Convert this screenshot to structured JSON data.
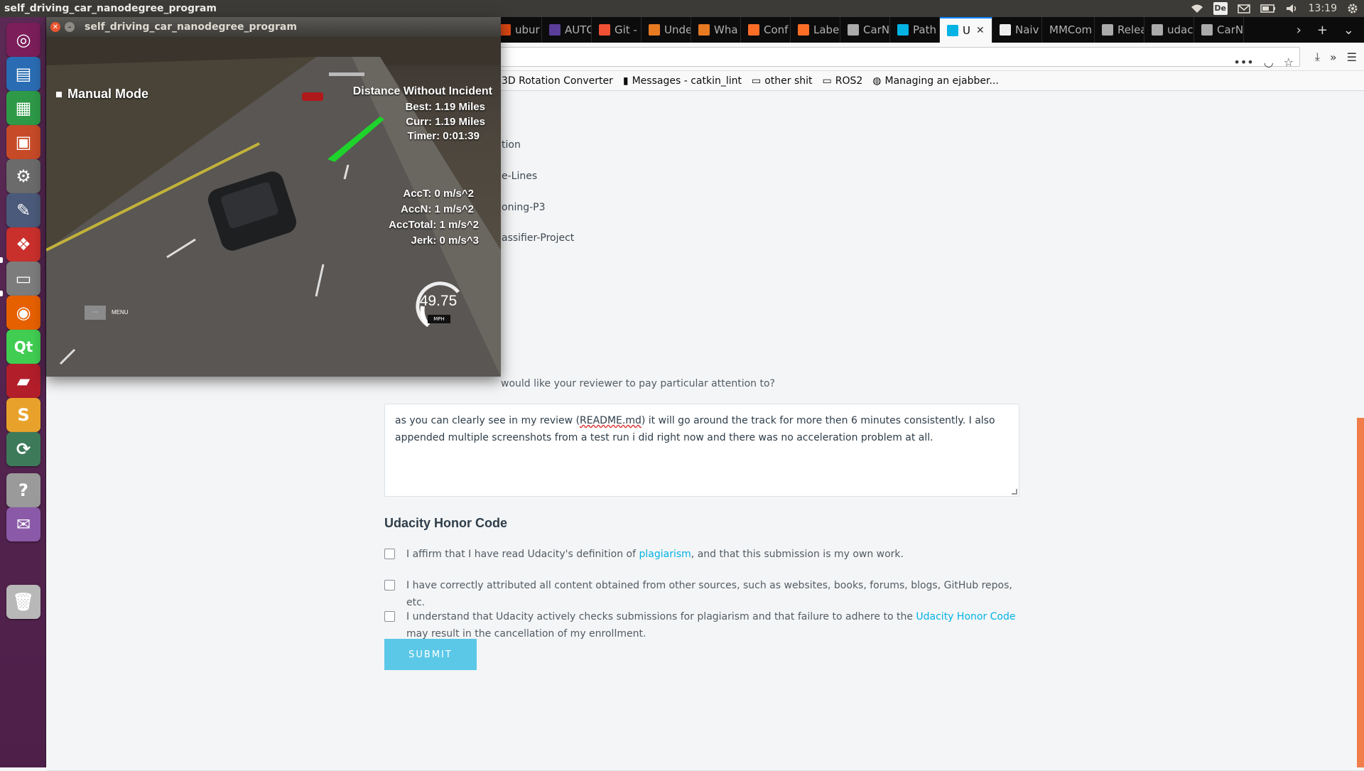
{
  "topbar": {
    "title": "self_driving_car_nanodegree_program",
    "keyboard": "De",
    "clock": "13:19"
  },
  "launcher": {
    "items": [
      {
        "name": "ubuntu-dash-icon",
        "color": "#7b1e5a"
      },
      {
        "name": "libreoffice-writer-icon",
        "color": "#2a6cb3"
      },
      {
        "name": "libreoffice-calc-icon",
        "color": "#2e9a48"
      },
      {
        "name": "libreoffice-impress-icon",
        "color": "#c74a28"
      },
      {
        "name": "system-settings-icon",
        "color": "#6b6b6b"
      },
      {
        "name": "gimp-icon",
        "color": "#4b5a7a"
      },
      {
        "name": "pdf-viewer-icon",
        "color": "#c9302c"
      },
      {
        "name": "files-icon",
        "color": "#7c7c7c"
      },
      {
        "name": "firefox-icon",
        "color": "#e66000"
      },
      {
        "name": "qt-creator-icon",
        "color": "#41cd52"
      },
      {
        "name": "terminal-icon",
        "color": "#b21e2a"
      },
      {
        "name": "sublime-text-icon",
        "color": "#e8a22c"
      },
      {
        "name": "software-updater-icon",
        "color": "#3d7a5a"
      },
      {
        "name": "help-icon",
        "color": "#9a9a9a"
      },
      {
        "name": "pidgin-icon",
        "color": "#8a5aa8"
      },
      {
        "name": "trash-icon",
        "color": "#b8b8b8"
      }
    ]
  },
  "browser": {
    "tabs": [
      {
        "label": "ubur",
        "icon": "ubuntu-icon",
        "color": "#dd4814"
      },
      {
        "label": "AUTO",
        "icon": "autoware-icon",
        "color": "#5a3e9a"
      },
      {
        "label": "Git -",
        "icon": "git-icon",
        "color": "#f05033"
      },
      {
        "label": "Unde",
        "icon": "stackexchange-icon",
        "color": "#e87a22"
      },
      {
        "label": "Wha",
        "icon": "stackexchange-icon",
        "color": "#e87a22"
      },
      {
        "label": "Conf",
        "icon": "gitlab-icon",
        "color": "#fc6d26"
      },
      {
        "label": "Labe",
        "icon": "gitlab-icon",
        "color": "#fc6d26"
      },
      {
        "label": "CarN",
        "icon": "github-icon",
        "color": "#aaaaaa"
      },
      {
        "label": "Path",
        "icon": "udacity-icon",
        "color": "#02b3e4"
      },
      {
        "label": "U",
        "icon": "udacity-icon",
        "color": "#02b3e4"
      },
      {
        "label": "Naiv",
        "icon": "wikipedia-icon",
        "color": "#eeeeee"
      },
      {
        "label": "MMCom",
        "icon": "none",
        "color": "#444444"
      },
      {
        "label": "Relea",
        "icon": "github-icon",
        "color": "#aaaaaa"
      },
      {
        "label": "udac",
        "icon": "github-icon",
        "color": "#aaaaaa"
      },
      {
        "label": "CarN",
        "icon": "github-icon",
        "color": "#aaaaaa"
      }
    ],
    "active_tab_close": "✕",
    "bookmarks": [
      {
        "label": "3D Rotation Converter",
        "icon": "none"
      },
      {
        "label": "Messages - catkin_lint",
        "icon": "book-icon"
      },
      {
        "label": "other shit",
        "icon": "folder-icon"
      },
      {
        "label": "ROS2",
        "icon": "folder-icon"
      },
      {
        "label": "Managing an ejabber...",
        "icon": "chat-icon"
      }
    ]
  },
  "page": {
    "fragments": [
      "tion",
      "e-Lines",
      "oning-P3",
      "assifier-Project"
    ],
    "review_question": "would like your reviewer to pay particular attention to?",
    "note_text_before": "as you can clearly see in my review (",
    "note_text_readme": "README.md",
    "note_text_after": ") it will go around the track for more then 6 minutes consistently. I also appended multiple screenshots from a test run i did right now and there was no acceleration problem at all.",
    "honor_title": "Udacity Honor Code",
    "check1_before": "I affirm that I have read Udacity's definition of ",
    "check1_link": "plagiarism",
    "check1_after": ", and that this submission is my own work.",
    "check2": "I have correctly attributed all content obtained from other sources, such as websites, books, forums, blogs, GitHub repos, etc.",
    "check3_before": "I understand that Udacity actively checks submissions for plagiarism and that failure to adhere to the ",
    "check3_link": "Udacity Honor Code",
    "check3_after": " may result in the cancellation of my enrollment.",
    "submit": "SUBMIT"
  },
  "simulator": {
    "title": "self_driving_car_nanodegree_program",
    "mode": "Manual Mode",
    "distance_title": "Distance Without Incident",
    "best": "Best: 1.19 Miles",
    "curr": "Curr: 1.19 Miles",
    "timer": "Timer: 0:01:39",
    "acct": "AccT: 0 m/s^2",
    "accn": "AccN: 1 m/s^2",
    "acctotal": "AccTotal: 1 m/s^2",
    "jerk": "Jerk: 0 m/s^3",
    "speed": "49.75",
    "speed_unit": "MPH",
    "menu_btn": "···",
    "menu_label": "MENU"
  }
}
